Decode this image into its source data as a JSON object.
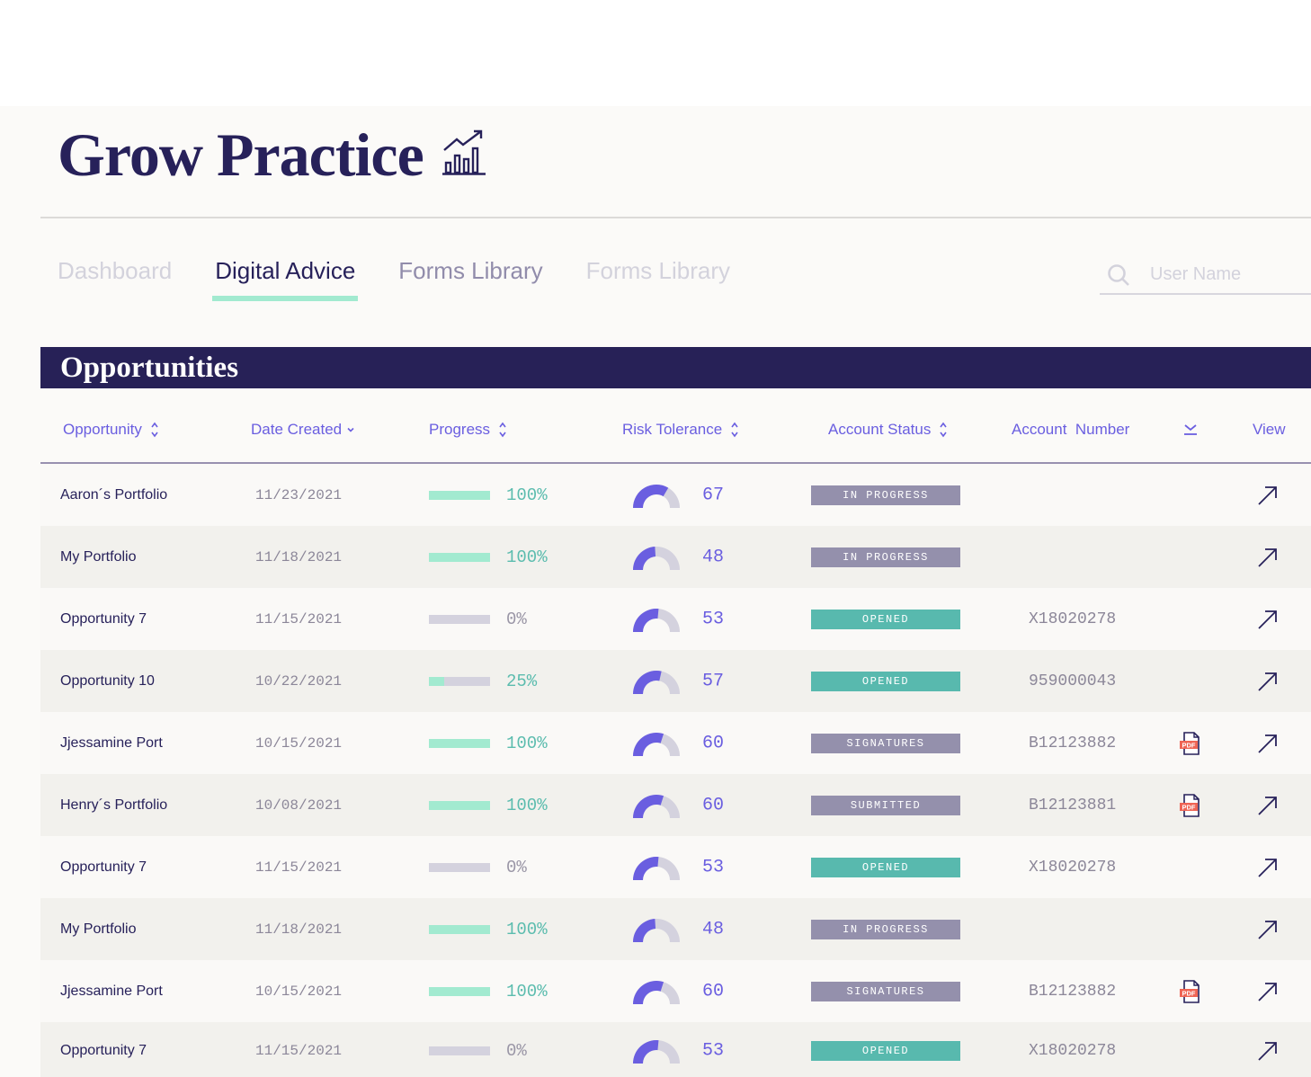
{
  "header": {
    "title": "Grow Practice",
    "icon": "growth-chart-icon"
  },
  "tabs": [
    {
      "label": "Dashboard",
      "state": "disabled"
    },
    {
      "label": "Digital Advice",
      "state": "active"
    },
    {
      "label": "Forms Library",
      "state": "normal"
    },
    {
      "label": "Forms Library",
      "state": "disabled"
    }
  ],
  "search": {
    "placeholder": "User Name",
    "value": "",
    "icon": "search-icon"
  },
  "section": {
    "title": "Opportunities"
  },
  "columns": {
    "opportunity": "Opportunity",
    "date_created": "Date Created",
    "progress": "Progress",
    "risk_tolerance": "Risk Tolerance",
    "account_status": "Account Status",
    "account_number": "Account  Number",
    "download_icon": "download-icon",
    "view": "View"
  },
  "colors": {
    "navy": "#272157",
    "accent_purple": "#6a5ee0",
    "progress_green": "#a2ead0",
    "status_opened": "#58b9ae",
    "status_neutral": "#9490ac",
    "pdf_red": "#ef6454"
  },
  "rows": [
    {
      "name": "Aaron´s Portfolio",
      "date": "11/23/2021",
      "progress": 100,
      "progress_label": "100%",
      "risk": 67,
      "risk_label": "67",
      "status": "IN PROGRESS",
      "status_type": "neutral",
      "account": "",
      "pdf": false
    },
    {
      "name": "My Portfolio",
      "date": "11/18/2021",
      "progress": 100,
      "progress_label": "100%",
      "risk": 48,
      "risk_label": "48",
      "status": "IN PROGRESS",
      "status_type": "neutral",
      "account": "",
      "pdf": false
    },
    {
      "name": "Opportunity 7",
      "date": "11/15/2021",
      "progress": 0,
      "progress_label": "0%",
      "risk": 53,
      "risk_label": "53",
      "status": "OPENED",
      "status_type": "opened",
      "account": "X18020278",
      "pdf": false
    },
    {
      "name": "Opportunity 10",
      "date": "10/22/2021",
      "progress": 25,
      "progress_label": "25%",
      "risk": 57,
      "risk_label": "57",
      "status": "OPENED",
      "status_type": "opened",
      "account": "959000043",
      "pdf": false
    },
    {
      "name": "Jjessamine Port",
      "date": "10/15/2021",
      "progress": 100,
      "progress_label": "100%",
      "risk": 60,
      "risk_label": "60",
      "status": "SIGNATURES",
      "status_type": "neutral",
      "account": "B12123882",
      "pdf": true
    },
    {
      "name": "Henry´s Portfolio",
      "date": "10/08/2021",
      "progress": 100,
      "progress_label": "100%",
      "risk": 60,
      "risk_label": "60",
      "status": "SUBMITTED",
      "status_type": "neutral",
      "account": "B12123881",
      "pdf": true
    },
    {
      "name": "Opportunity 7",
      "date": "11/15/2021",
      "progress": 0,
      "progress_label": "0%",
      "risk": 53,
      "risk_label": "53",
      "status": "OPENED",
      "status_type": "opened",
      "account": "X18020278",
      "pdf": false
    },
    {
      "name": "My Portfolio",
      "date": "11/18/2021",
      "progress": 100,
      "progress_label": "100%",
      "risk": 48,
      "risk_label": "48",
      "status": "IN PROGRESS",
      "status_type": "neutral",
      "account": "",
      "pdf": false
    },
    {
      "name": "Jjessamine Port",
      "date": "10/15/2021",
      "progress": 100,
      "progress_label": "100%",
      "risk": 60,
      "risk_label": "60",
      "status": "SIGNATURES",
      "status_type": "neutral",
      "account": "B12123882",
      "pdf": true
    },
    {
      "name": "Opportunity 7",
      "date": "11/15/2021",
      "progress": 0,
      "progress_label": "0%",
      "risk": 53,
      "risk_label": "53",
      "status": "OPENED",
      "status_type": "opened",
      "account": "X18020278",
      "pdf": false
    }
  ],
  "pdf_label": "PDF"
}
